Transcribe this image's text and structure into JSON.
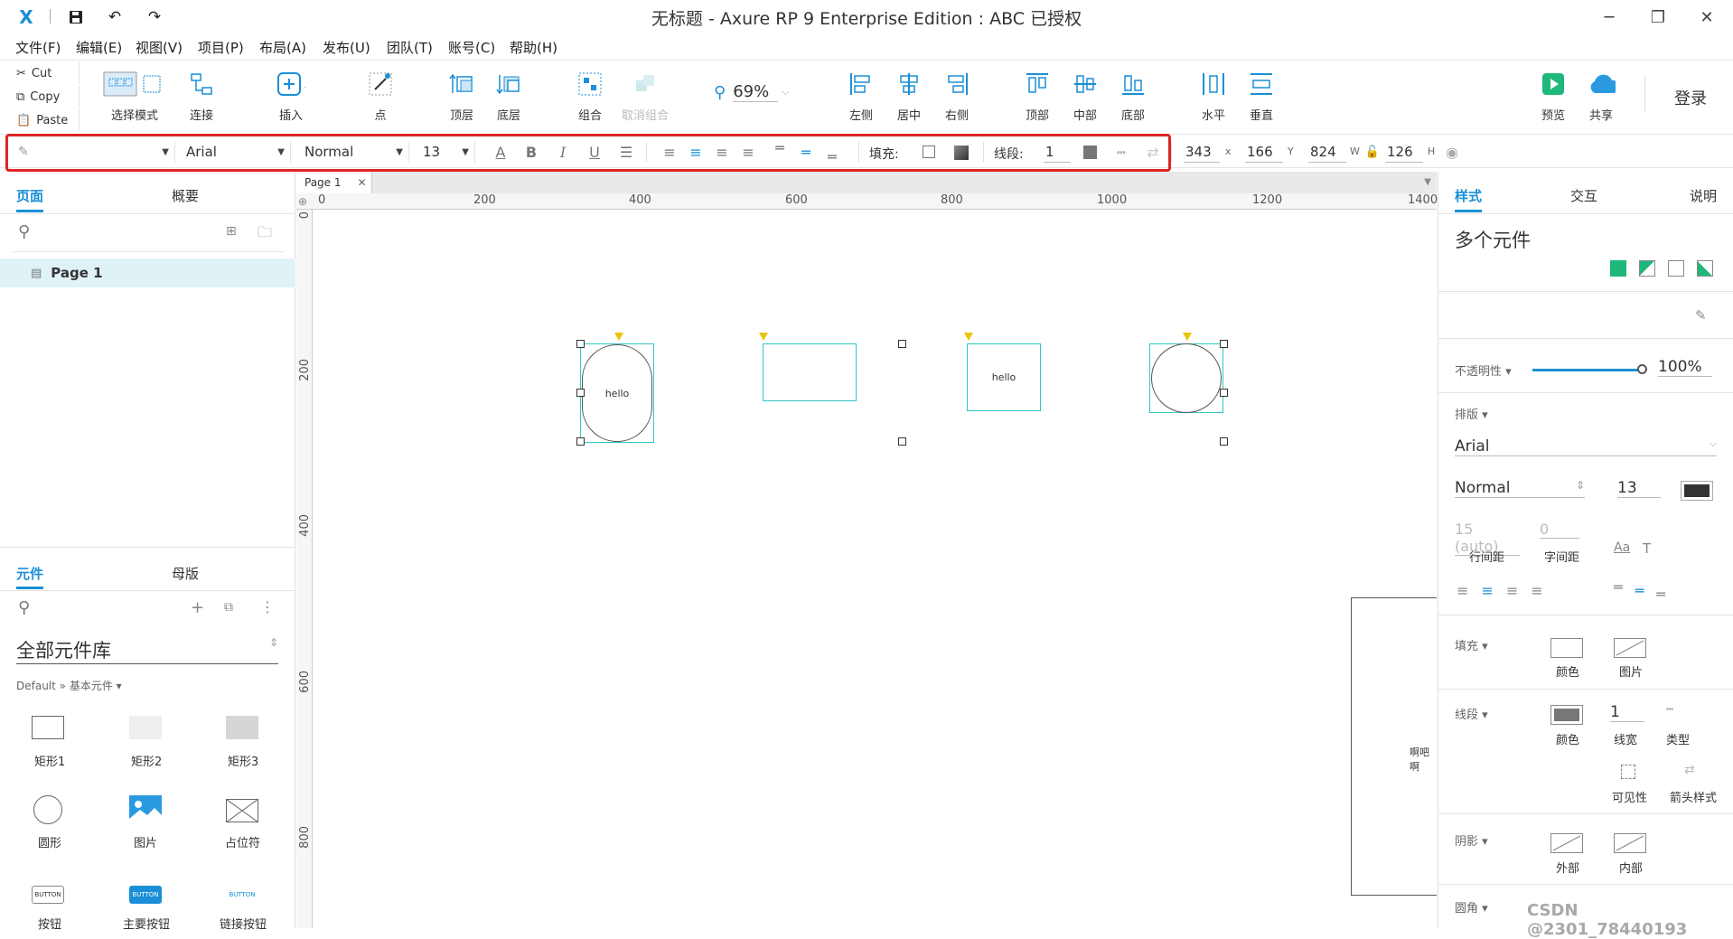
{
  "window": {
    "title": "无标题 - Axure RP 9 Enterprise Edition : ABC 已授权",
    "controls": {
      "minimize": "─",
      "restore": "❐",
      "close": "✕"
    }
  },
  "quick_actions": {
    "save_icon": "save-icon",
    "undo_icon": "undo-icon",
    "redo_icon": "redo-icon"
  },
  "menu": [
    "文件(F)",
    "编辑(E)",
    "视图(V)",
    "项目(P)",
    "布局(A)",
    "发布(U)",
    "团队(T)",
    "账号(C)",
    "帮助(H)"
  ],
  "clipboard": {
    "cut": "Cut",
    "copy": "Copy",
    "paste": "Paste"
  },
  "toolbar": {
    "select_mode": "选择模式",
    "connect": "连接",
    "insert": "插入",
    "point": "点",
    "top_layer": "顶层",
    "bottom_layer": "底层",
    "group": "组合",
    "ungroup": "取消组合",
    "zoom": "69%",
    "align_left": "左侧",
    "align_center": "居中",
    "align_right": "右侧",
    "align_top": "顶部",
    "align_middle": "中部",
    "align_bottom": "底部",
    "dist_horizontal": "水平",
    "dist_vertical": "垂直",
    "preview": "预览",
    "share": "共享",
    "login": "登录"
  },
  "format_bar": {
    "font_family": "Arial",
    "font_weight": "Normal",
    "font_size": "13",
    "fill_label": "填充:",
    "line_label": "线段:",
    "line_width": "1",
    "x": "343",
    "x_unit": "x",
    "y": "166",
    "y_unit": "Y",
    "w": "824",
    "w_unit": "W",
    "h": "126",
    "h_unit": "H"
  },
  "left_panel": {
    "tabs": [
      "页面",
      "概要"
    ],
    "pages": [
      {
        "label": "Page 1"
      }
    ],
    "lib_tabs": [
      "元件",
      "母版"
    ],
    "library_name": "全部元件库",
    "library_path": "Default » 基本元件 ▾",
    "widgets": [
      {
        "label": "矩形1"
      },
      {
        "label": "矩形2"
      },
      {
        "label": "矩形3"
      },
      {
        "label": "圆形"
      },
      {
        "label": "图片"
      },
      {
        "label": "占位符"
      },
      {
        "label": "按钮"
      },
      {
        "label": "主要按钮"
      },
      {
        "label": "链接按钮"
      }
    ],
    "button_thumb_text": "BUTTON"
  },
  "canvas": {
    "doc_tab": "Page 1",
    "ruler_h": [
      "0",
      "200",
      "400",
      "600",
      "800",
      "1000",
      "1200",
      "1400"
    ],
    "ruler_v": [
      "0",
      "200",
      "400",
      "600",
      "800"
    ],
    "shape_texts": {
      "rounded": "hello",
      "rect2": "hello",
      "far_right": "啊吧啊"
    }
  },
  "right_panel": {
    "tabs": [
      "样式",
      "交互",
      "说明"
    ],
    "selection_title": "多个元件",
    "opacity_label": "不透明性 ▾",
    "opacity_value": "100%",
    "opacity_fraction": 1.0,
    "typography_label": "排版 ▾",
    "font_family": "Arial",
    "font_weight": "Normal",
    "font_size": "13",
    "line_height": "15 (auto)",
    "letter_spacing": "0",
    "line_height_label": "行间距",
    "letter_spacing_label": "字间距",
    "fill_label": "填充 ▾",
    "fill_color_label": "颜色",
    "fill_image_label": "图片",
    "line_label": "线段 ▾",
    "line_color_label": "颜色",
    "line_width": "1",
    "line_width_label": "线宽",
    "line_type_label": "类型",
    "visibility_label": "可见性",
    "arrow_label": "箭头样式",
    "shadow_label": "阴影 ▾",
    "shadow_outer": "外部",
    "shadow_inner": "内部",
    "corner_label": "圆角 ▾"
  },
  "watermark": "CSDN @2301_78440193",
  "colors": {
    "accent": "#1a8fd6",
    "shape_border": "#2ec8c8",
    "highlight": "#e02424",
    "marker": "#e8c50a"
  }
}
